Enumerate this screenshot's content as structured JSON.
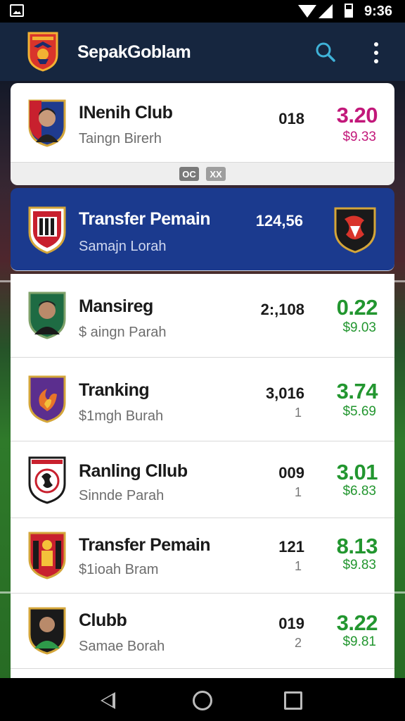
{
  "status_bar": {
    "time": "9:36"
  },
  "app_bar": {
    "title": "SepakGoblam"
  },
  "rows": [
    {
      "name": "INenih Club",
      "sub": "Taingn Birerh",
      "num": "018",
      "subnum": "",
      "price": "3.20",
      "subprice": "$9.33",
      "price_color": "#c2187a"
    },
    {
      "name": "Transfer Pemain",
      "sub": "Samajn Lorah",
      "num": "124,56",
      "subnum": "",
      "price": "",
      "subprice": ""
    },
    {
      "name": "Mansireg",
      "sub": "$ aingn Parah",
      "num": "2:,108",
      "subnum": "",
      "price": "0.22",
      "subprice": "$9.03"
    },
    {
      "name": "Tranking",
      "sub": "$1mgh Burah",
      "num": "3,016",
      "subnum": "1",
      "price": "3.74",
      "subprice": "$5.69"
    },
    {
      "name": "Ranling Cllub",
      "sub": "Sinnde Parah",
      "num": "009",
      "subnum": "1",
      "price": "3.01",
      "subprice": "$6.83"
    },
    {
      "name": "Transfer Pemain",
      "sub": "$1ioah Bram",
      "num": "121",
      "subnum": "1",
      "price": "8.13",
      "subprice": "$9.83"
    },
    {
      "name": "Clubb",
      "sub": "Samae Borah",
      "num": "019",
      "subnum": "2",
      "price": "3.22",
      "subprice": "$9.81"
    }
  ],
  "expander": {
    "chip_left": "OC",
    "chip_right": "XX"
  },
  "colors": {
    "app_bar": "#16263f",
    "selected_row": "#1b3a8e",
    "price_green": "#22962f",
    "price_magenta": "#c2187a"
  },
  "icons": [
    "image-icon",
    "wifi-icon",
    "signal-icon",
    "battery-icon",
    "app-logo-icon",
    "search-icon",
    "more-vert-icon",
    "back-icon",
    "home-icon",
    "recent-apps-icon"
  ]
}
